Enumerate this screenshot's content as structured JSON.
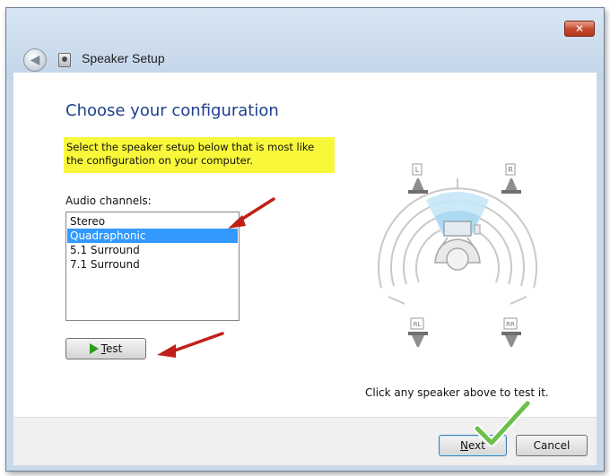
{
  "window": {
    "title": "Speaker Setup",
    "close_symbol": "✕",
    "back_symbol": "◀",
    "app_icon": "speaker-setup-icon"
  },
  "page": {
    "heading": "Choose your configuration",
    "instruction": "Select the speaker setup below that is most like the configuration on your computer.",
    "instruction_highlight": "#f8f73a"
  },
  "channels": {
    "label": "Audio channels:",
    "items": [
      "Stereo",
      "Quadraphonic",
      "5.1 Surround",
      "7.1 Surround"
    ],
    "selected": "Quadraphonic"
  },
  "test_button": {
    "label_accel": "T",
    "label_rest": "est"
  },
  "diagram": {
    "speakers": {
      "front_left": "L",
      "front_right": "R",
      "rear_left": "RL",
      "rear_right": "RR"
    }
  },
  "hint": "Click any speaker above to test it.",
  "footer": {
    "next_accel": "N",
    "next_rest": "ext",
    "cancel": "Cancel"
  },
  "colors": {
    "heading": "#1e3f8c",
    "selection": "#3399ff",
    "annotation_arrow": "#c0201a",
    "annotation_check": "#6cc04a"
  }
}
